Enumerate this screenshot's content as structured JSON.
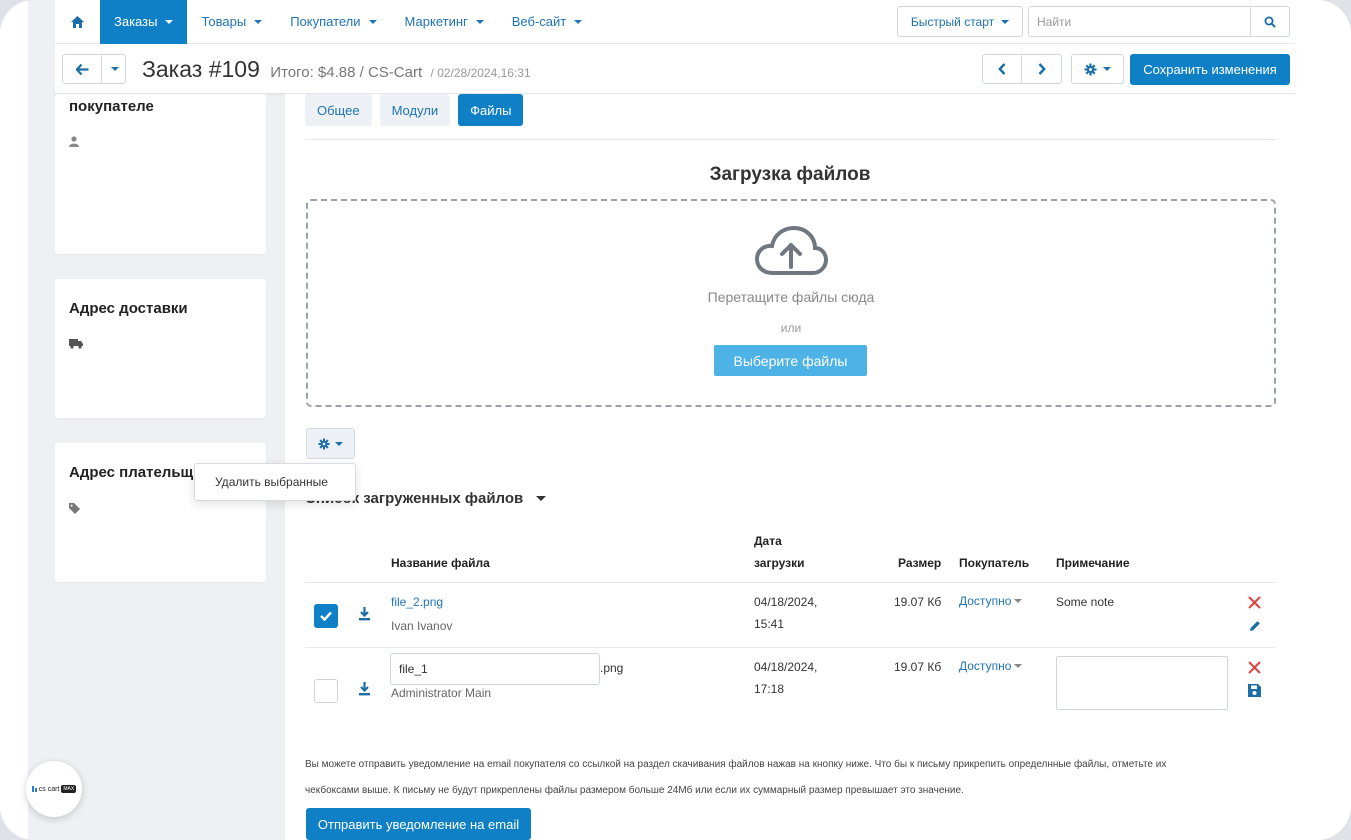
{
  "nav": {
    "items": [
      {
        "label": "Заказы",
        "active": true
      },
      {
        "label": "Товары",
        "active": false
      },
      {
        "label": "Покупатели",
        "active": false
      },
      {
        "label": "Маркетинг",
        "active": false
      },
      {
        "label": "Веб-сайт",
        "active": false
      }
    ],
    "quick_start": "Быстрый старт",
    "search_placeholder": "Найти"
  },
  "order": {
    "title": "Заказ #109",
    "total": "Итого: $4.88 / CS-Cart",
    "date": "/ 02/28/2024,16:31",
    "save_label": "Сохранить изменения"
  },
  "sidebar": {
    "customer_title": "покупателе",
    "shipping_title": "Адрес доставки",
    "billing_title": "Адрес плательщ"
  },
  "tabs": [
    {
      "label": "Общее",
      "active": false
    },
    {
      "label": "Модули",
      "active": false
    },
    {
      "label": "Файлы",
      "active": true
    }
  ],
  "upload": {
    "heading": "Загрузка файлов",
    "drop_text": "Перетащите файлы сюда",
    "or_text": "или",
    "choose_label": "Выберите файлы"
  },
  "actions_menu": {
    "delete_selected": "Удалить выбранные"
  },
  "files": {
    "heading": "Список загруженных файлов",
    "columns": {
      "name": "Название файла",
      "date_line1": "Дата",
      "date_line2": "загрузки",
      "size": "Размер",
      "customer": "Покупатель",
      "note": "Примечание"
    },
    "rows": [
      {
        "checked": true,
        "name": "file_2.png",
        "uploader": "Ivan Ivanov",
        "date": "04/18/2024,",
        "time": "15:41",
        "size": "19.07 Кб",
        "availability": "Доступно",
        "note": "Some note"
      },
      {
        "checked": false,
        "name_input": "file_1",
        "extension": ".png",
        "uploader": "Administrator Main",
        "date": "04/18/2024,",
        "time": "17:18",
        "size": "19.07 Кб",
        "availability": "Доступно",
        "note": ""
      }
    ]
  },
  "info": {
    "line1": "Вы можете отправить уведомление на email покупателя со ссылкой на раздел скачивания файлов нажав на кнопку ниже. Что бы к письму прикрепить определнные файлы, отметьте их",
    "line2": "чекбоксами выше. К письму не будут прикреплены файлы размером больше 24Мб или если их суммарный размер превышает это значение.",
    "notify_label": "Отправить уведомление на email"
  },
  "logo": {
    "text": "cs cart",
    "tag": "MAX"
  },
  "colors": {
    "accent": "#0f80c6",
    "danger": "#e0433d",
    "link": "#2074b6"
  }
}
